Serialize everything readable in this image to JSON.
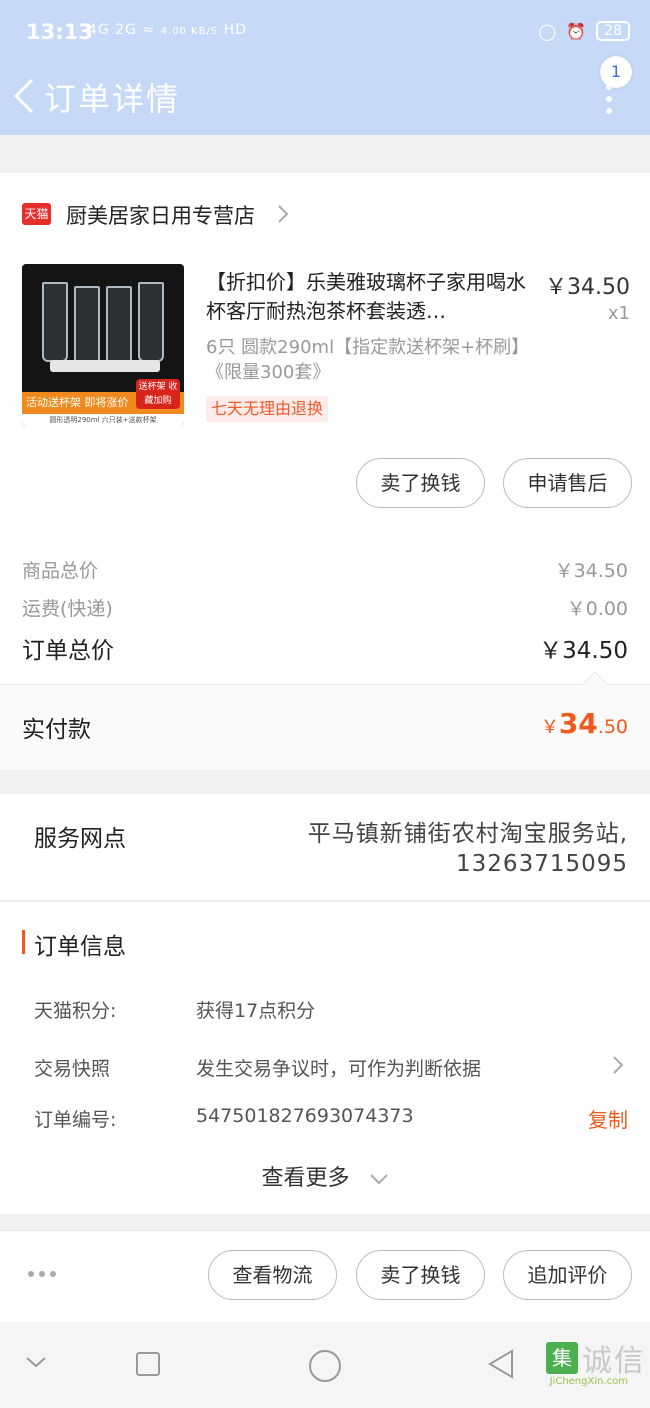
{
  "status_bar": {
    "time": "13:13",
    "signal": "4G 2G",
    "net_speed": "4.00 KB/S",
    "hd": "HD",
    "battery": "28"
  },
  "nav": {
    "title": "订单详情",
    "badge": "1"
  },
  "shop": {
    "badge": "天猫",
    "name": "厨美居家日用专营店"
  },
  "product": {
    "title": "【折扣价】乐美雅玻璃杯子家用喝水杯客厅耐热泡茶杯套装透…",
    "price": "￥34.50",
    "qty": "x1",
    "sku": "6只 圆款290ml【指定款送杯架+杯刷】《限量300套》",
    "tag": "七天无理由退换",
    "image_banner": "活动送杯架 即将涨价",
    "image_tag": "送杯架 收藏加购",
    "image_foot": "圆形透明290ml 六只装+送款杯架"
  },
  "product_buttons": {
    "sell": "卖了换钱",
    "aftersale": "申请售后"
  },
  "price_rows": {
    "goods_label": "商品总价",
    "goods_value": "￥34.50",
    "shipping_label": "运费(快递)",
    "shipping_value": "￥0.00",
    "total_label": "订单总价",
    "total_value": "￥34.50"
  },
  "paid": {
    "label": "实付款",
    "symbol": "￥",
    "integer": "34",
    "decimal": ".50"
  },
  "service": {
    "label": "服务网点",
    "name": "平马镇新铺街农村淘宝服务站,",
    "phone": "13263715095"
  },
  "order_info": {
    "heading": "订单信息",
    "points_label": "天猫积分:",
    "points_value": "获得17点积分",
    "snapshot_label": "交易快照",
    "snapshot_value": "发生交易争议时，可作为判断依据",
    "order_no_label": "订单编号:",
    "order_no_value": "547501827693074373",
    "copy": "复制",
    "more": "查看更多"
  },
  "actions": {
    "logistics": "查看物流",
    "sell": "卖了换钱",
    "review": "追加评价"
  },
  "watermark": {
    "icon": "集",
    "cn": "诚信",
    "en": "JiChengXin.com"
  },
  "colors": {
    "header_bg": "#c6d9f7",
    "accent": "#ef5a1c",
    "tmall_red": "#e82d2d"
  }
}
